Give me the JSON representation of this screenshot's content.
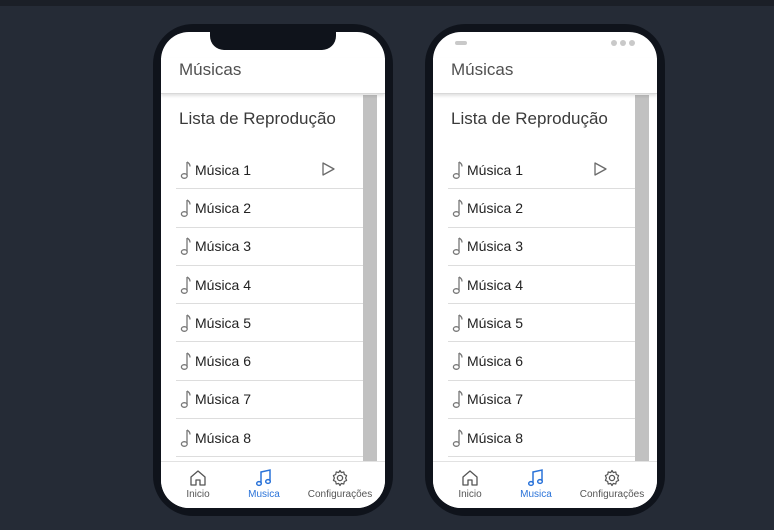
{
  "colors": {
    "background": "#252b36",
    "active_tab": "#2a73d9",
    "inactive_tab": "#555555"
  },
  "phones": [
    {
      "header_title": "Músicas",
      "list_title": "Lista de Reprodução",
      "songs": [
        "Música 1",
        "Música 2",
        "Música 3",
        "Música 4",
        "Música 5",
        "Música 6",
        "Música 7",
        "Música 8"
      ],
      "tabs": {
        "home": "Inicio",
        "music": "Musica",
        "settings": "Configurações"
      },
      "active_tab": "Musica"
    },
    {
      "header_title": "Músicas",
      "list_title": "Lista de Reprodução",
      "songs": [
        "Música 1",
        "Música 2",
        "Música 3",
        "Música 4",
        "Música 5",
        "Música 6",
        "Música 7",
        "Música 8"
      ],
      "tabs": {
        "home": "Inicio",
        "music": "Musica",
        "settings": "Configurações"
      },
      "active_tab": "Musica"
    }
  ],
  "icons": {
    "song": "music-note-icon",
    "play": "play-icon",
    "home": "home-icon",
    "music": "music-tab-icon",
    "settings": "gear-icon"
  }
}
